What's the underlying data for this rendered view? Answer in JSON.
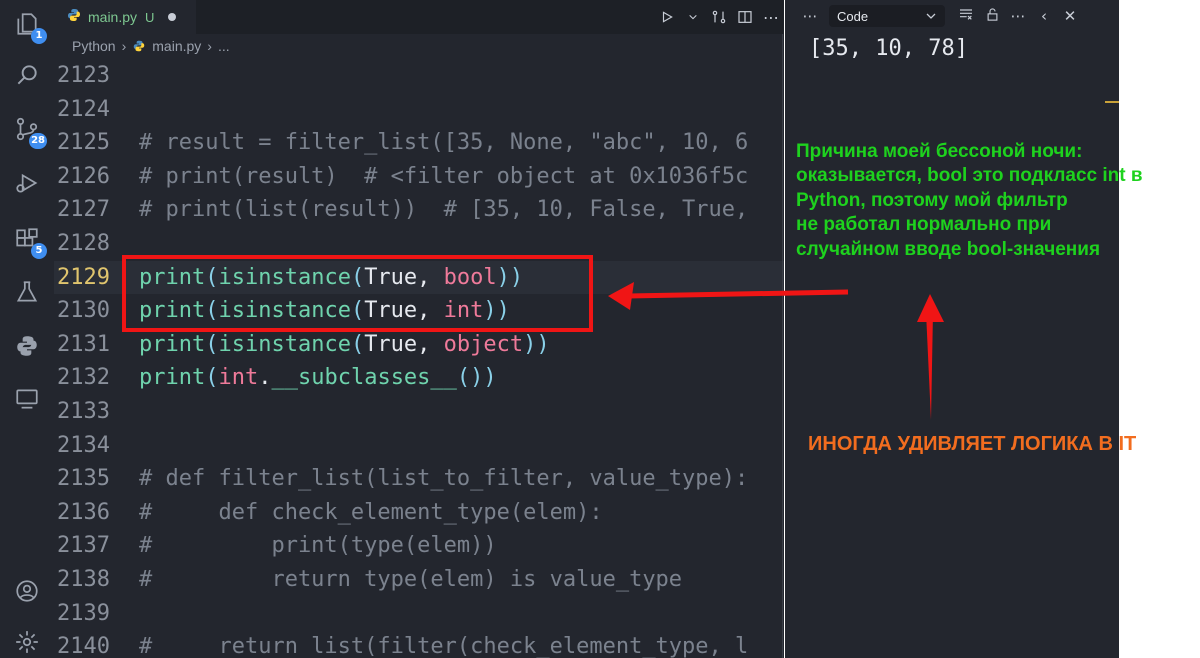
{
  "activity_bar": {
    "badges": {
      "explorer": "1",
      "source_control": "28",
      "extensions": "5"
    }
  },
  "editor": {
    "tab": {
      "filename": "main.py",
      "status": "U"
    },
    "breadcrumb": {
      "language": "Python",
      "file": "main.py",
      "more": "..."
    },
    "lines": [
      {
        "number": "2123",
        "text": ""
      },
      {
        "number": "2124",
        "text": ""
      },
      {
        "number": "2125",
        "text": "# result = filter_list([35, None, \"abc\", 10, 6"
      },
      {
        "number": "2126",
        "text": "# print(result)  # <filter object at 0x1036f5c"
      },
      {
        "number": "2127",
        "text": "# print(list(result))  # [35, 10, False, True,"
      },
      {
        "number": "2128",
        "text": ""
      },
      {
        "number": "2129",
        "text": "print(isinstance(True, bool))"
      },
      {
        "number": "2130",
        "text": "print(isinstance(True, int))"
      },
      {
        "number": "2131",
        "text": "print(isinstance(True, object))"
      },
      {
        "number": "2132",
        "text": "print(int.__subclasses__())"
      },
      {
        "number": "2133",
        "text": ""
      },
      {
        "number": "2134",
        "text": ""
      },
      {
        "number": "2135",
        "text": "# def filter_list(list_to_filter, value_type):"
      },
      {
        "number": "2136",
        "text": "#     def check_element_type(elem):"
      },
      {
        "number": "2137",
        "text": "#         print(type(elem))"
      },
      {
        "number": "2138",
        "text": "#         return type(elem) is value_type"
      },
      {
        "number": "2139",
        "text": ""
      },
      {
        "number": "2140",
        "text": "#     return list(filter(check_element_type, l"
      }
    ],
    "active_line": "2129"
  },
  "output_panel": {
    "selector": "Code",
    "output_text": "[35, 10, 78]"
  },
  "annotation": {
    "note_lines": [
      "Причина моей бессоной ночи:",
      "оказывается, bool это подкласс int в",
      "Python, поэтому мой фильтр",
      "не работал нормально при",
      "случайном вводе bool-значения"
    ],
    "caption": "ИНОГДА УДИВЛЯЕТ ЛОГИКА В IT"
  },
  "colors": {
    "annotation_green": "#1ed21e",
    "annotation_orange": "#f26d1f",
    "highlight_red": "#f01515",
    "editor_bg": "#23262e"
  }
}
